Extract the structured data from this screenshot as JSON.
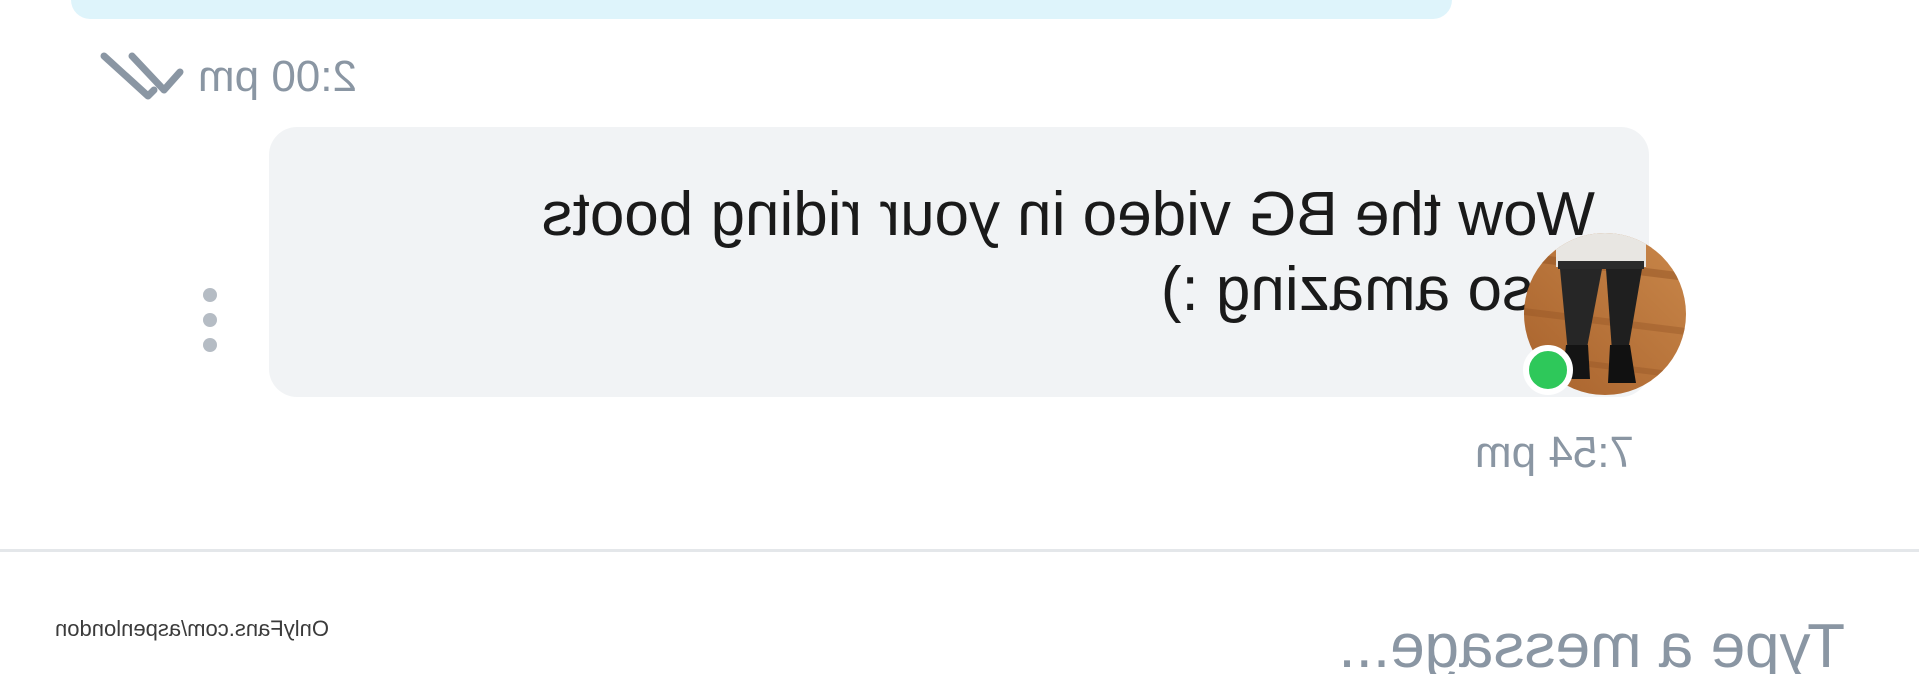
{
  "thread": {
    "sent_message": {
      "time": "2:00 pm",
      "status_icon": "double-check-icon"
    },
    "received_message": {
      "lines": [
        "Wow the BG video in your riding boots",
        "is so amazing :)"
      ],
      "time": "7:54 pm",
      "sender_online": true,
      "options_icon": "more-vertical-icon"
    }
  },
  "composer": {
    "placeholder": "Type a message..."
  },
  "watermark": "OnlyFans.com/aspenlondon",
  "colors": {
    "sent_bubble": "#def4fb",
    "received_bubble": "#f1f3f5",
    "meta_text": "#8a96a3",
    "online": "#2ec85a",
    "divider": "#e4e7ea"
  },
  "rendering": {
    "mirrored_horizontally": true
  }
}
